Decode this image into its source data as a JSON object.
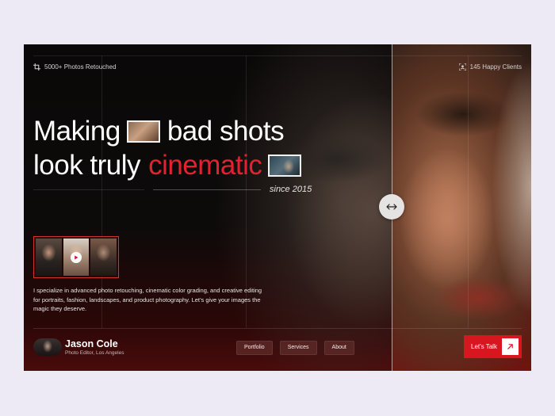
{
  "stats": {
    "retouched": "5000+ Photos Retouched",
    "clients": "145 Happy Clients"
  },
  "headline": {
    "line1_start": "Making",
    "line1_end": "bad shots",
    "line2_start": "look truly",
    "line2_accent": "cinematic",
    "tagline": "since 2015"
  },
  "description": "I specialize in advanced photo retouching, cinematic color grading, and creative editing for portraits, fashion, landscapes, and product photography. Let’s give your images the magic they deserve.",
  "profile": {
    "name": "Jason Cole",
    "role": "Photo Editor, Los Angeles"
  },
  "nav": {
    "items": [
      {
        "label": "Portfolio"
      },
      {
        "label": "Services"
      },
      {
        "label": "About"
      }
    ]
  },
  "cta": {
    "label": "Let's Talk"
  },
  "icons": {
    "retouched": "crop-icon",
    "clients": "face-scan-icon",
    "handle": "horizontal-arrows-icon",
    "play": "play-icon",
    "cta": "arrow-up-right-icon"
  },
  "colors": {
    "accent": "#e2222e",
    "cta": "#d81620",
    "page_bg": "#edeaf6"
  }
}
